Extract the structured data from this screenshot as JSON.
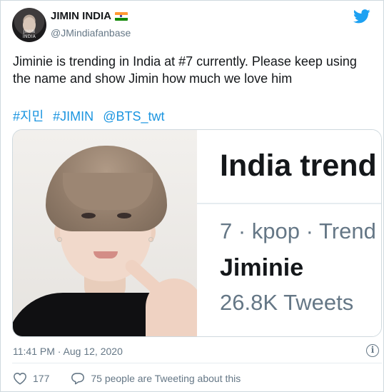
{
  "tweet": {
    "display_name": "JIMIN INDIA",
    "handle": "@JMindiafanbase",
    "avatar_watermark": "JIMIN INDIA",
    "text": "Jiminie is trending in India at #7 currently. Please keep using the name and show Jimin how much we love him",
    "hashtags": [
      "#지민",
      "#JIMIN",
      "@BTS_twt"
    ],
    "timestamp": "11:41 PM · Aug 12, 2020",
    "like_count": "177",
    "retweet_text": "75 people are Tweeting about this"
  },
  "trend_card": {
    "title": "India trend",
    "meta": "7 · kpop · Trend",
    "name": "Jiminie",
    "count": "26.8K Tweets"
  },
  "colors": {
    "link": "#1b95e0",
    "brand": "#1da1f2",
    "secondary_text": "#657786",
    "flag_saffron": "#ff9933",
    "flag_green": "#138808"
  },
  "icons": {
    "brand": "twitter-bird-icon",
    "flag": "india-flag-icon",
    "info": "info-icon",
    "like": "heart-icon",
    "reply": "speech-bubble-icon"
  }
}
